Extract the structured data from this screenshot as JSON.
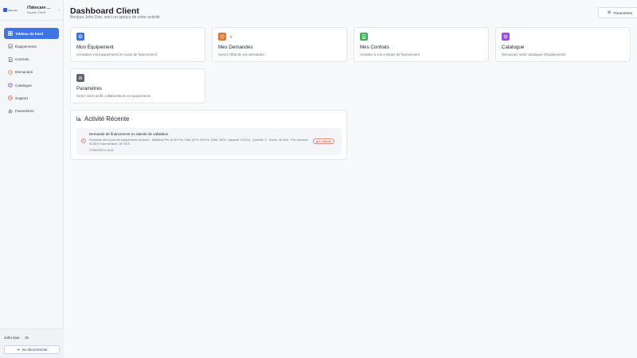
{
  "brand": {
    "logo_text": "itakecare",
    "name": "iTakecare ...",
    "subtitle": "Espace Client",
    "collapse_icon": "chevron-left-icon"
  },
  "sidebar": {
    "items": [
      {
        "label": "Tableau de bord",
        "icon": "dashboard-icon",
        "active": true
      },
      {
        "label": "Équipements",
        "icon": "laptop-icon",
        "active": false
      },
      {
        "label": "Contrats",
        "icon": "document-icon",
        "active": false
      },
      {
        "label": "Demandes",
        "icon": "clock-icon",
        "active": false
      },
      {
        "label": "Catalogue",
        "icon": "box-icon",
        "active": false
      },
      {
        "label": "Support",
        "icon": "help-icon",
        "active": false
      },
      {
        "label": "Paramètres",
        "icon": "gear-icon",
        "active": false
      }
    ],
    "footer": {
      "user_name": "John Doe",
      "user_initials": "JD",
      "logout_label": "Se déconnecter"
    }
  },
  "header": {
    "title": "Dashboard Client",
    "subtitle": "Bonjour John Doe, voici un aperçu de votre activité",
    "settings_label": "Paramètres"
  },
  "cards": [
    {
      "title": "Mon Équipement",
      "desc": "Consultez vos équipements en cours de financement",
      "icon": "monitor-icon",
      "color": "#3b6fe0"
    },
    {
      "title": "Mes Demandes",
      "desc": "Suivez l'état de vos demandes",
      "icon": "clock-icon",
      "color": "#e8732c",
      "badge": "0"
    },
    {
      "title": "Mes Contrats",
      "desc": "Accédez à vos contrats de financement",
      "icon": "document-icon",
      "color": "#3fb45a"
    },
    {
      "title": "Catalogue",
      "desc": "Découvrez notre catalogue d'équipements",
      "icon": "box-icon",
      "color": "#9b4fe0"
    },
    {
      "title": "Paramètres",
      "desc": "Gérez votre profil, collaborateurs et équipements",
      "icon": "gear-icon",
      "color": "#5b6270"
    }
  ],
  "activity": {
    "title": "Activité Récente",
    "items": [
      {
        "title": "Demande de financement en attente de validation",
        "desc": "Demande client pour les équipements suivants: - MacBook Pro 16 M3 Pro / Max (CPU: M3 Pro, RAM: 18Go, Capacité: 512Go) - Quantité: 2 - Durée: 36 mois - Prix mensuel: 93.85 € Total mensuel: 187.90 €",
        "date": "27/06/2025 à 16:42",
        "status": "En attente",
        "status_color": "#c2413a"
      }
    ]
  }
}
